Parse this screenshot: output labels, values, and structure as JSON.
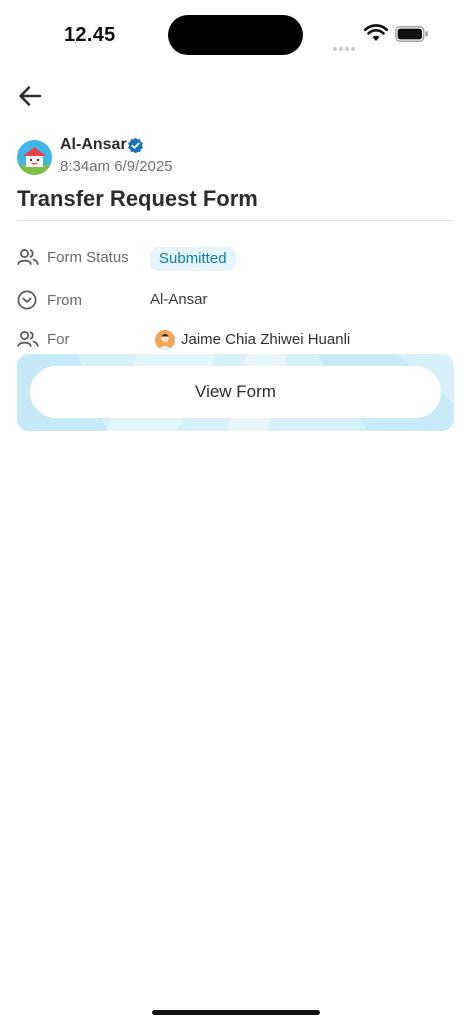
{
  "status_bar": {
    "time": "12.45"
  },
  "post": {
    "org_name": "Al-Ansar",
    "timestamp": "8:34am 6/9/2025",
    "title": "Transfer Request Form"
  },
  "fields": {
    "status_label": "Form Status",
    "status_value": "Submitted",
    "from_label": "From",
    "from_value": "Al-Ansar",
    "for_label": "For",
    "for_value": "Jaime Chia Zhiwei Huanli"
  },
  "actions": {
    "view_form_label": "View Form"
  },
  "colors": {
    "accent": "#0a7ea6",
    "badge_bg": "#e6f5fb",
    "card_bg": "#d7f0fa",
    "verified": "#1a73b8"
  },
  "icons": {
    "back": "arrow-left-icon",
    "verified": "verified-check-icon",
    "status": "people-icon",
    "from": "chevron-circle-down-icon",
    "for": "people-icon"
  }
}
